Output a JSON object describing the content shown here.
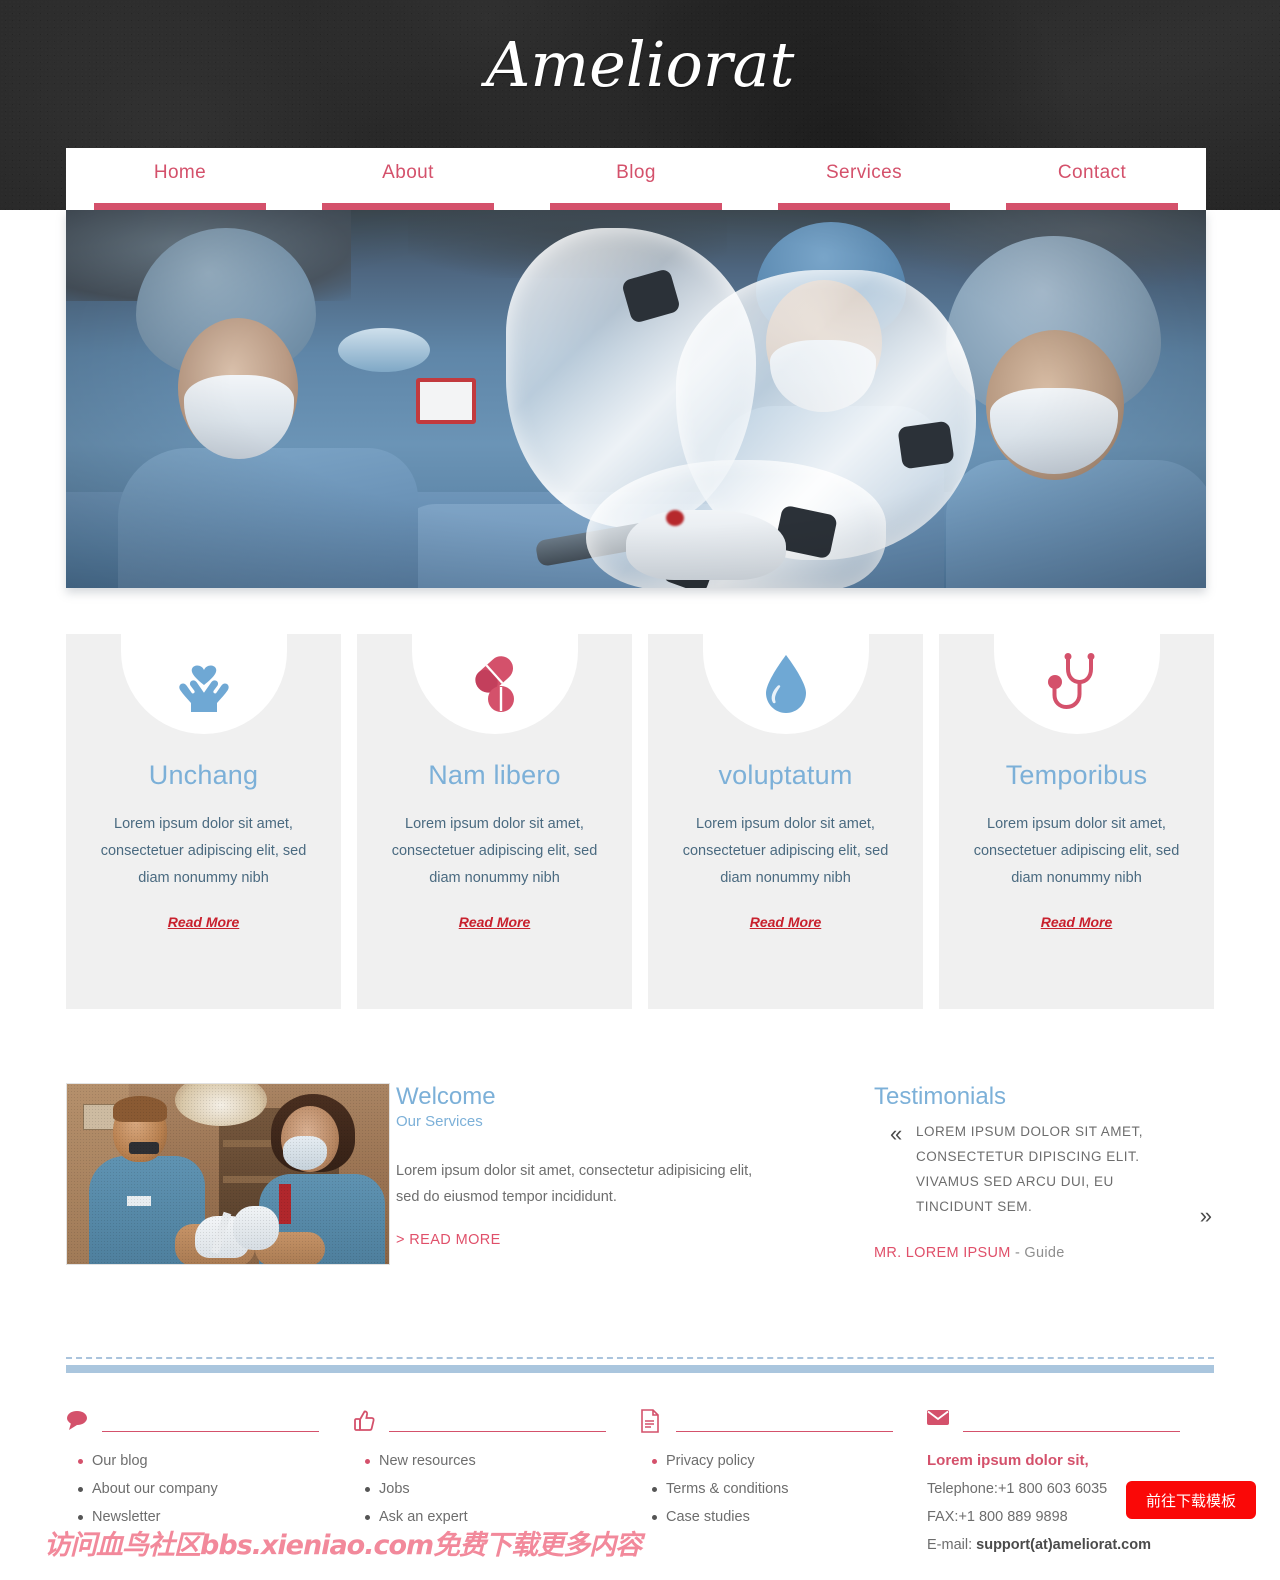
{
  "site": {
    "logo": "Ameliorat",
    "accent_pink": "#d4516b",
    "accent_blue": "#7cb0d8",
    "card_bg": "#f0f0f0",
    "header_bg": "#2a2a2a"
  },
  "nav": {
    "items": [
      {
        "label": "Home"
      },
      {
        "label": "About"
      },
      {
        "label": "Blog"
      },
      {
        "label": "Services"
      },
      {
        "label": "Contact"
      }
    ]
  },
  "hero": {
    "alt": "surgical team operating with microscope draped in sterile plastic"
  },
  "services": {
    "cards": [
      {
        "icon": "hands-heart-icon",
        "icon_color": "#6fa8d4",
        "title": "Unchang",
        "text": "Lorem ipsum dolor sit amet, consectetuer adipiscing elit, sed diam nonummy nibh",
        "more": "Read More"
      },
      {
        "icon": "pills-icon",
        "icon_color": "#d4516b",
        "title": "Nam libero",
        "text": "Lorem ipsum dolor sit amet, consectetuer adipiscing elit, sed diam nonummy nibh",
        "more": "Read More"
      },
      {
        "icon": "water-drop-icon",
        "icon_color": "#6fa8d4",
        "title": "voluptatum",
        "text": "Lorem ipsum dolor sit amet, consectetuer adipiscing elit, sed diam nonummy nibh",
        "more": "Read More"
      },
      {
        "icon": "stethoscope-icon",
        "icon_color": "#d4516b",
        "title": "Temporibus",
        "text": "Lorem ipsum dolor sit amet, consectetuer adipiscing elit, sed diam nonummy nibh",
        "more": "Read More"
      }
    ]
  },
  "welcome": {
    "photo_alt": "two dental professionals in blue scrubs working in a clinic",
    "title": "Welcome",
    "subtitle": "Our Services",
    "body": "Lorem ipsum dolor sit amet, consectetur adipisicing elit, sed do eiusmod tempor incididunt.",
    "read_more": "> READ MORE"
  },
  "testimonials": {
    "title": "Testimonials",
    "quote_open": "«",
    "quote_close": "»",
    "quote": "LOREM IPSUM DOLOR SIT AMET, CONSECTETUR DIPISCING ELIT. VIVAMUS SED ARCU DUI, EU TINCIDUNT SEM.",
    "author_name": "MR. LOREM IPSUM",
    "author_role": "- Guide"
  },
  "footer": {
    "columns": [
      {
        "icon": "speech-bubble-icon",
        "items": [
          "Our blog",
          "About our company",
          "Newsletter"
        ]
      },
      {
        "icon": "thumbs-up-icon",
        "items": [
          "New resources",
          "Jobs",
          "Ask an expert"
        ]
      },
      {
        "icon": "document-icon",
        "items": [
          "Privacy policy",
          "Terms & conditions",
          "Case studies"
        ]
      }
    ],
    "contact": {
      "icon": "envelope-icon",
      "title": "Lorem ipsum dolor sit,",
      "telephone_label": "Telephone:",
      "telephone_value": "+1 800 603 6035",
      "fax_label": "FAX:",
      "fax_value": "+1 800 889 9898",
      "email_label": "E-mail: ",
      "email_value": "support(at)ameliorat.com"
    }
  },
  "overlay": {
    "watermark": "访问血鸟社区bbs.xieniao.com免费下载更多内容",
    "download_button": "前往下载模板"
  }
}
